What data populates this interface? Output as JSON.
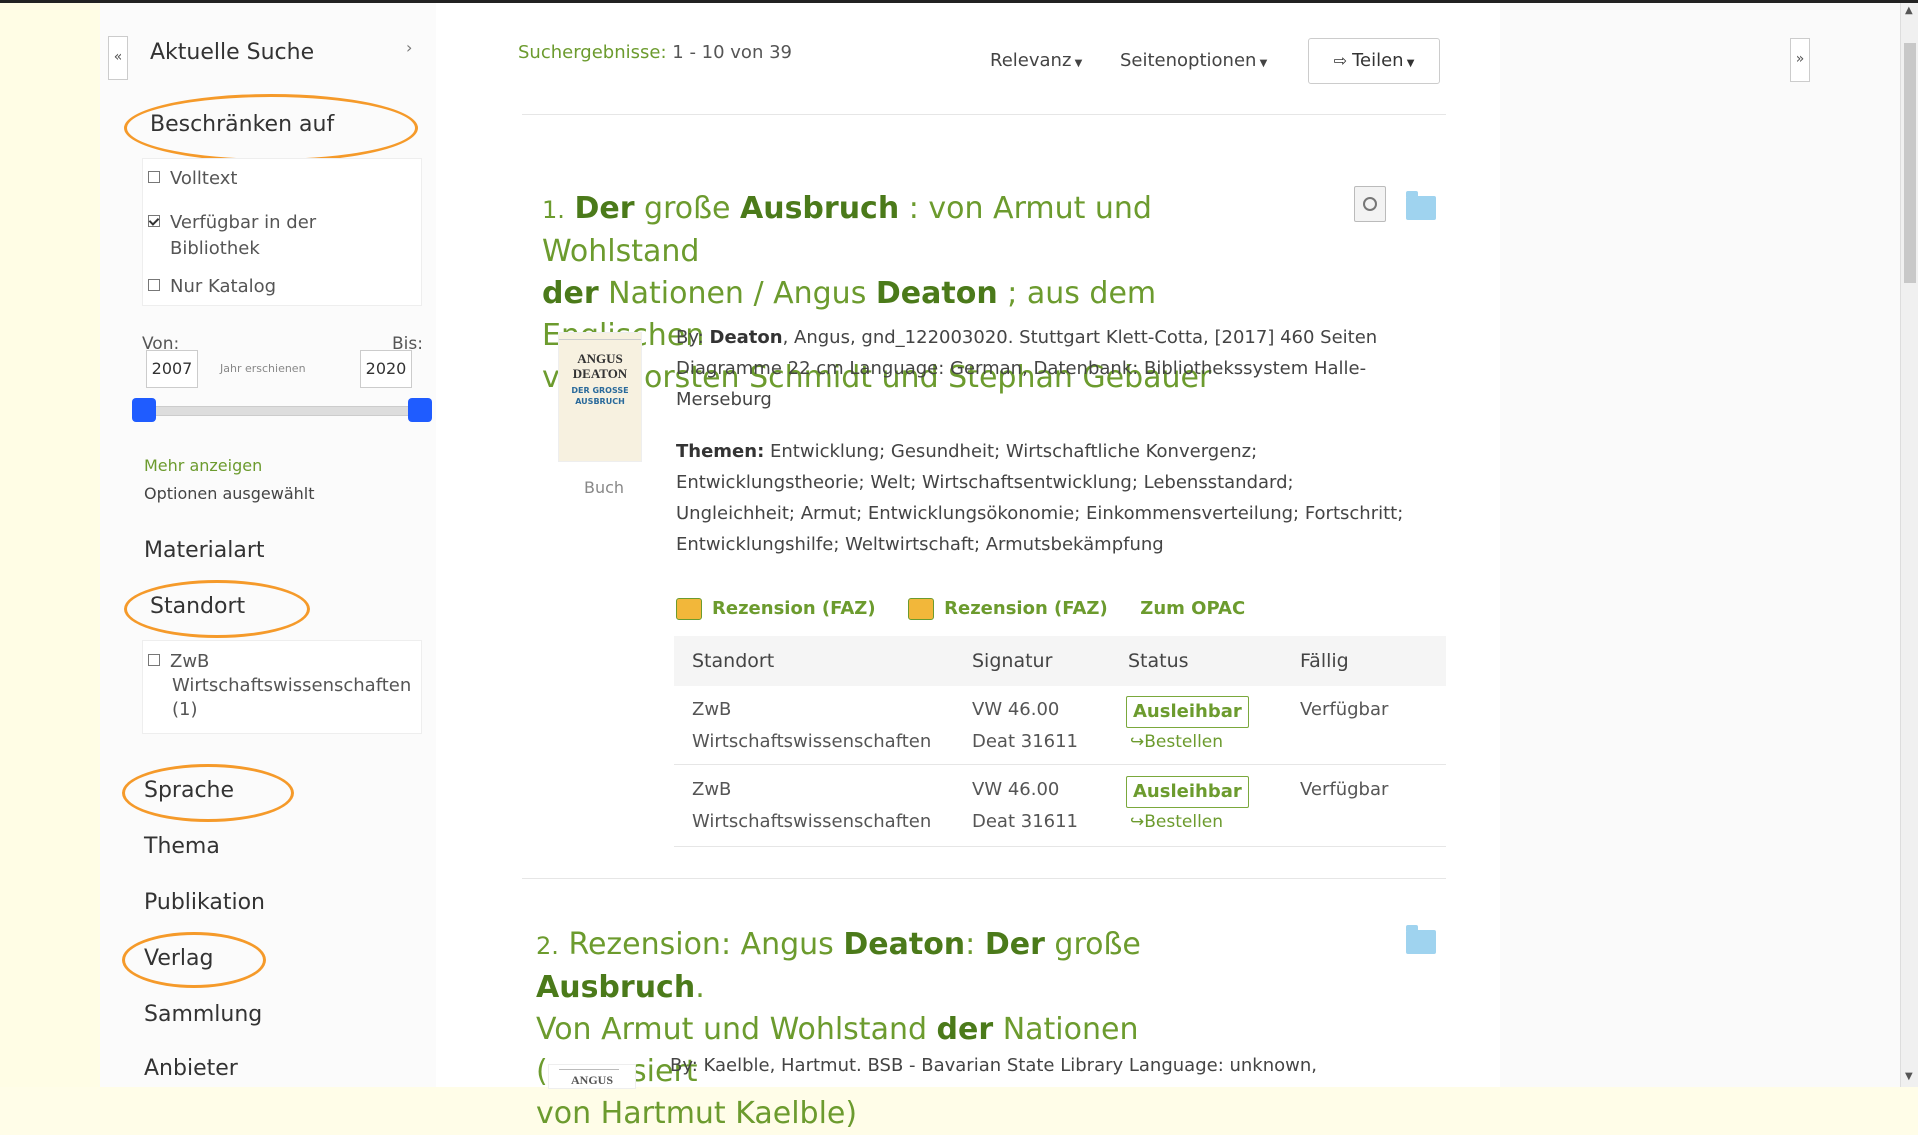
{
  "sidebar": {
    "collapse_left": "«",
    "current_search": "Aktuelle Suche",
    "current_search_arrow": "›",
    "limit_heading": "Beschränken auf",
    "limit_options": [
      {
        "label": "Volltext",
        "checked": false
      },
      {
        "label": "Verfügbar in der Bibliothek",
        "checked": true
      },
      {
        "label": "Nur Katalog",
        "checked": false
      }
    ],
    "from_label": "Von:",
    "to_label": "Bis:",
    "from_year": "2007",
    "to_year": "2020",
    "year_hint": "Jahr erschienen",
    "show_more": "Mehr anzeigen",
    "options_selected": "Optionen ausgewählt",
    "material_type": "Materialart",
    "location_heading": "Standort",
    "location_option_line1": "ZwB",
    "location_option_line2": "Wirtschaftswissenschaften",
    "location_option_count": "(1)",
    "language": "Sprache",
    "topic": "Thema",
    "publication": "Publikation",
    "publisher": "Verlag",
    "collection": "Sammlung",
    "provider": "Anbieter"
  },
  "toolbar": {
    "results_label": "Suchergebnisse:",
    "results_range": "1 - 10 von 39",
    "sort": "Relevanz",
    "page_options": "Seitenoptionen",
    "share": "Teilen"
  },
  "results": [
    {
      "number": "1.",
      "title_parts": [
        "Der",
        " große ",
        "Ausbruch",
        " : von Armut und Wohlstand"
      ],
      "title_line2_parts": [
        "der",
        " Nationen / Angus ",
        "Deaton",
        " ; aus dem Englischen"
      ],
      "title_line3": "von Thorsten Schmidt und Stephan Gebauer",
      "cover_lines": [
        "ANGUS",
        "DEATON",
        "DER GROSSE",
        "AUSBRUCH"
      ],
      "format": "Buch",
      "by_label": "By:",
      "author": "Deaton",
      "meta_line1_rest": ", Angus, gnd_122003020. Stuttgart Klett-Cotta, [2017] 460 Seiten",
      "meta_line2": "Diagramme 22 cm Language: German, Datenbank: Bibliothekssystem Halle-",
      "meta_line3": "Merseburg",
      "topics_label": "Themen:",
      "topics_line1": " Entwicklung; Gesundheit; Wirtschaftliche Konvergenz;",
      "topics_line2": "Entwicklungstheorie; Welt; Wirtschaftsentwicklung; Lebensstandard;",
      "topics_line3": "Ungleichheit; Armut; Entwicklungsökonomie; Einkommensverteilung; Fortschritt;",
      "topics_line4": "Entwicklungshilfe; Weltwirtschaft; Armutsbekämpfung",
      "links": [
        "Rezension (FAZ)",
        "Rezension (FAZ)",
        "Zum OPAC"
      ],
      "holdings_headers": [
        "Standort",
        "Signatur",
        "Status",
        "Fällig"
      ],
      "holdings": [
        {
          "loc1": "ZwB",
          "loc2": "Wirtschaftswissenschaften",
          "sig1": "VW 46.00",
          "sig2": "Deat 31611",
          "status": "Ausleihbar",
          "order": "↪Bestellen",
          "due": "Verfügbar"
        },
        {
          "loc1": "ZwB",
          "loc2": "Wirtschaftswissenschaften",
          "sig1": "VW 46.00",
          "sig2": "Deat 31611",
          "status": "Ausleihbar",
          "order": "↪Bestellen",
          "due": "Verfügbar"
        }
      ]
    },
    {
      "number": "2.",
      "title_line1_parts": [
        " Rezension: Angus ",
        "Deaton",
        ": ",
        "Der",
        " große ",
        "Ausbruch",
        "."
      ],
      "title_line2_parts": [
        "Von Armut und Wohlstand ",
        "der",
        " Nationen (rezensiert"
      ],
      "title_line3": "von Hartmut Kaelble)",
      "meta_line1": "By: Kaelble, Hartmut. BSB - Bavarian State Library Language: unknown,",
      "cover_text": "ANGUS"
    }
  ],
  "right": {
    "collapse_right": "»"
  }
}
